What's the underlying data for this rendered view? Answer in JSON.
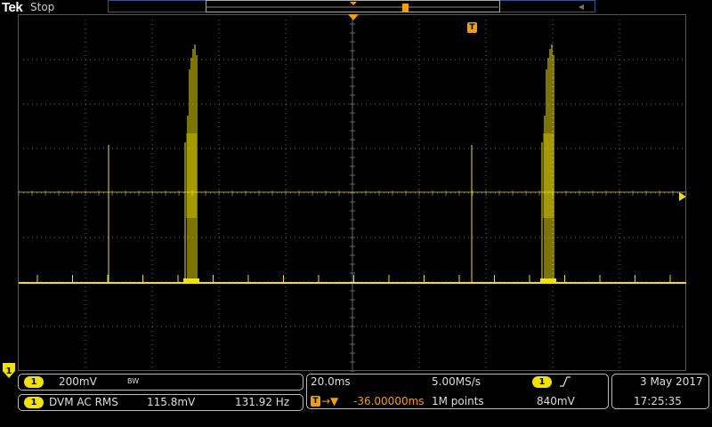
{
  "header": {
    "brand": "Tek",
    "acquisition_state": "Stop"
  },
  "trigger_marker": {
    "label": "T"
  },
  "channel": {
    "number": "1",
    "color": "#f2e200",
    "scale": "200mV",
    "bandwidth_limit": "BW"
  },
  "dvm": {
    "channel": "1",
    "mode": "DVM AC RMS",
    "value": "115.8mV",
    "frequency": "131.92 Hz"
  },
  "timebase": {
    "horizontal_scale": "20.0ms",
    "sample_rate": "5.00MS/s",
    "trigger_position": "-36.00000ms",
    "record_length": "1M points"
  },
  "trigger": {
    "channel": "1",
    "slope": "rising",
    "level": "840mV"
  },
  "datetime": {
    "date": "3 May 2017",
    "time": "17:25:35"
  }
}
